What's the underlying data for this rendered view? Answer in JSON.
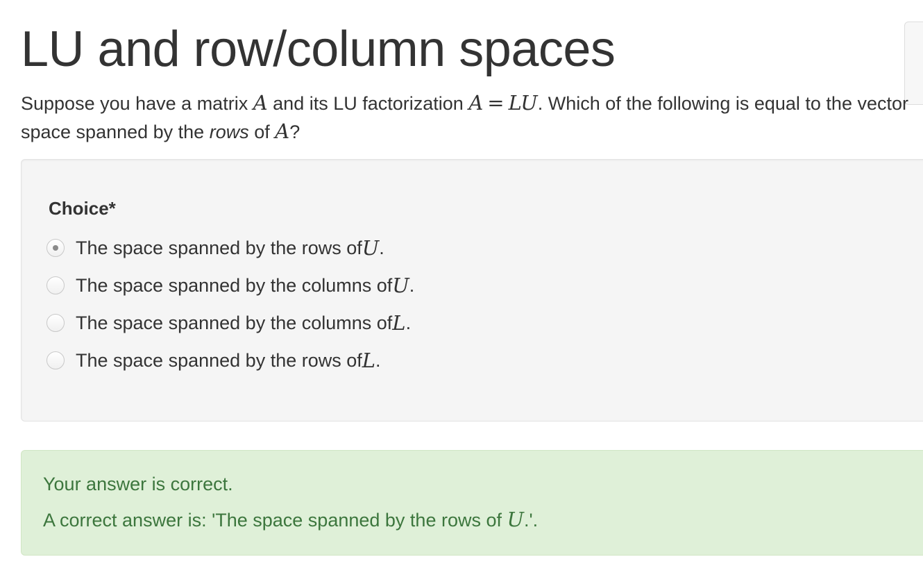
{
  "page": {
    "title": "LU and row/column spaces"
  },
  "question": {
    "text_1": "Suppose you have a matrix ",
    "math_A1": "A",
    "text_2": " and its LU factorization ",
    "math_A2": "A",
    "math_eq": "=",
    "math_LU": "LU",
    "text_3": ". Which of the following is equal to the vector space spanned by the ",
    "text_rows": "rows",
    "text_4": " of ",
    "math_A3": "A",
    "text_5": "?"
  },
  "choice": {
    "label": "Choice*",
    "options": [
      {
        "text": "The space spanned by the rows of ",
        "math": "U",
        "suffix": ".",
        "selected": true
      },
      {
        "text": "The space spanned by the columns of ",
        "math": "U",
        "suffix": ".",
        "selected": false
      },
      {
        "text": "The space spanned by the columns of ",
        "math": "L",
        "suffix": ".",
        "selected": false
      },
      {
        "text": "The space spanned by the rows of ",
        "math": "L",
        "suffix": ".",
        "selected": false
      }
    ]
  },
  "feedback": {
    "status": "Your answer is correct.",
    "answer_prefix": "A correct answer is: 'The space spanned by the rows of ",
    "answer_math": "U",
    "answer_suffix": ".'."
  },
  "colors": {
    "text": "#333333",
    "well_bg": "#f5f5f5",
    "success_bg": "#dff0d8",
    "success_text": "#3c763d"
  }
}
